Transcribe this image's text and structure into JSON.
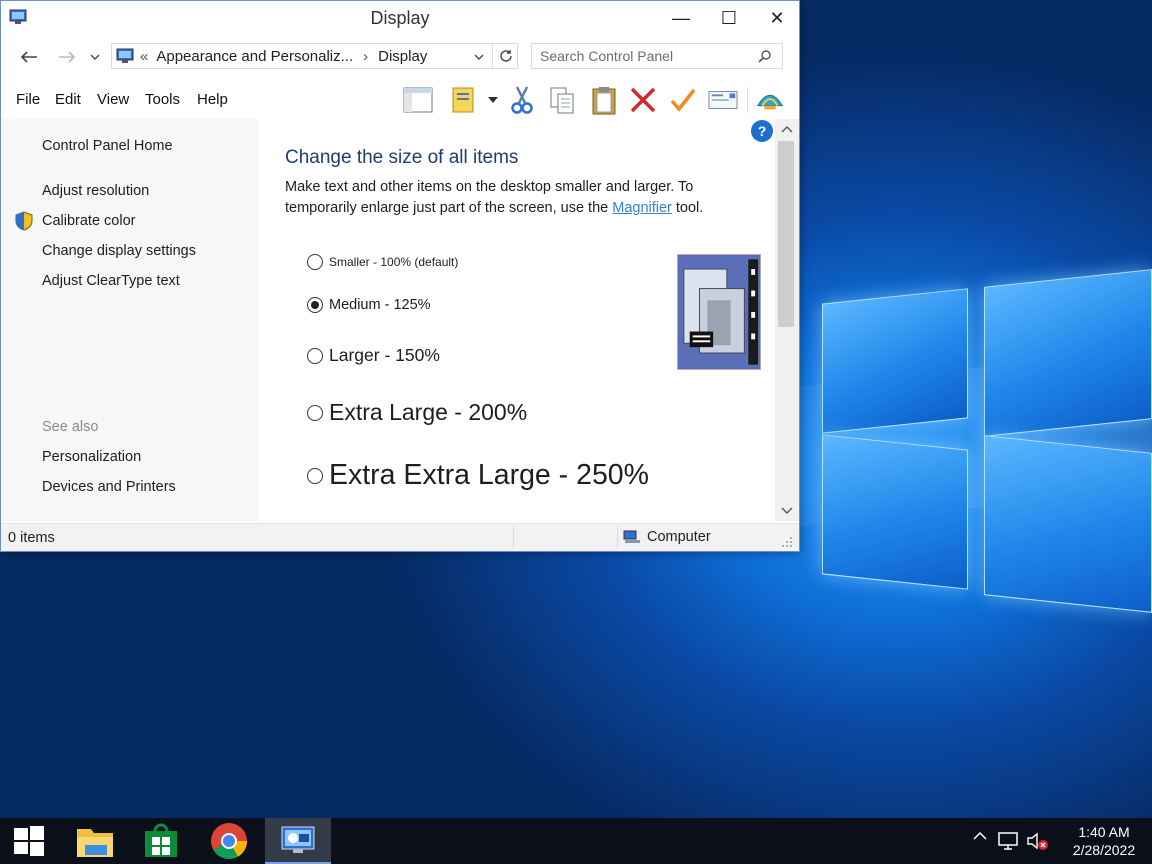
{
  "window": {
    "title": "Display",
    "minimize_glyph": "—",
    "maximize_glyph": "☐",
    "close_glyph": "✕"
  },
  "address": {
    "overflow": "«",
    "crumb1": "Appearance and Personaliz...",
    "separator": "›",
    "crumb2": "Display",
    "search_placeholder": "Search Control Panel"
  },
  "menu": {
    "file": "File",
    "edit": "Edit",
    "view": "View",
    "tools": "Tools",
    "help": "Help"
  },
  "toolbar_icons": [
    "layout-icon",
    "properties-icon",
    "cut-icon",
    "copy-icon",
    "paste-icon",
    "delete-icon",
    "check-icon",
    "mail-icon",
    "shell-icon"
  ],
  "sidebar": {
    "home": "Control Panel Home",
    "items": [
      {
        "label": "Adjust resolution"
      },
      {
        "label": "Calibrate color"
      },
      {
        "label": "Change display settings"
      },
      {
        "label": "Adjust ClearType text"
      }
    ],
    "see_also": "See also",
    "see_also_items": [
      {
        "label": "Personalization"
      },
      {
        "label": "Devices and Printers"
      }
    ]
  },
  "main": {
    "heading": "Change the size of all items",
    "description_before": "Make text and other items on the desktop smaller and larger. To temporarily enlarge just part of the screen, use the ",
    "description_link": "Magnifier",
    "description_after": " tool.",
    "options": [
      {
        "label": "Smaller - 100% (default)",
        "checked": false
      },
      {
        "label": "Medium - 125%",
        "checked": true
      },
      {
        "label": "Larger - 150%",
        "checked": false
      },
      {
        "label": "Extra Large - 200%",
        "checked": false
      },
      {
        "label": "Extra Extra Large - 250%",
        "checked": false
      }
    ],
    "help_glyph": "?"
  },
  "status": {
    "items": "0 items",
    "location": "Computer"
  },
  "taskbar": {
    "time": "1:40 AM",
    "date": "2/28/2022",
    "tray_chevron": "^"
  },
  "colors": {
    "heading": "#1e3e6e",
    "link": "#3b7fd6",
    "taskbar": "#0b0f1a",
    "accent_blue": "#1c6fd1"
  }
}
